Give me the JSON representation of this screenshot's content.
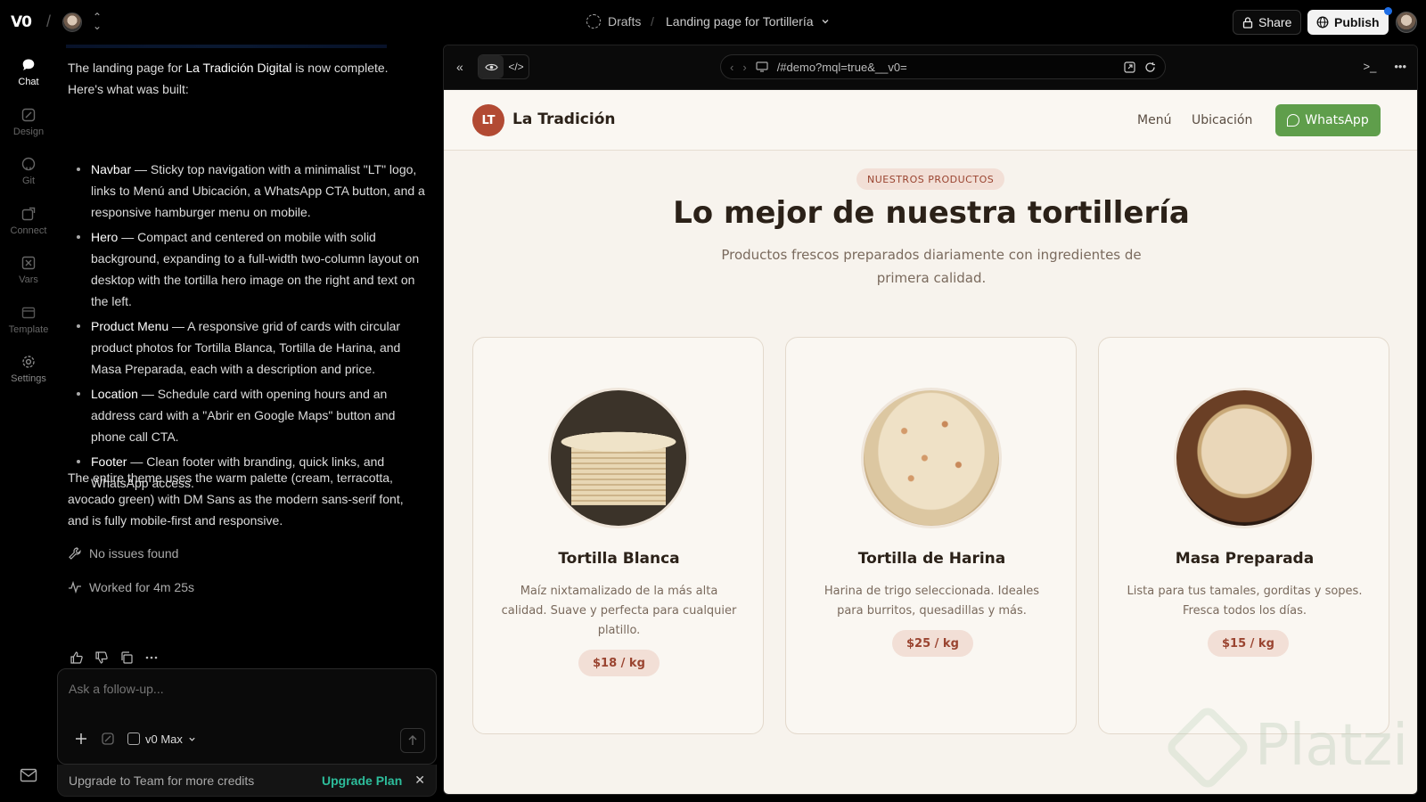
{
  "topbar": {
    "logo": "V0",
    "breadcrumb_drafts": "Drafts",
    "breadcrumb_sep": "/",
    "project_name": "Landing page for Tortillería",
    "share": "Share",
    "publish": "Publish"
  },
  "rail": {
    "items": [
      {
        "label": "Chat",
        "icon": "chat-icon"
      },
      {
        "label": "Design",
        "icon": "design-icon"
      },
      {
        "label": "Git",
        "icon": "github-icon"
      },
      {
        "label": "Connect",
        "icon": "connect-icon"
      },
      {
        "label": "Vars",
        "icon": "vars-icon"
      },
      {
        "label": "Template",
        "icon": "template-icon"
      },
      {
        "label": "Settings",
        "icon": "gear-icon"
      }
    ]
  },
  "chat": {
    "intro_pre": "The landing page for ",
    "intro_name": "La Tradición Digital",
    "intro_post": " is now complete. Here's what was built:",
    "bullets": [
      {
        "title": "Navbar",
        "text": " — Sticky top navigation with a minimalist \"LT\" logo, links to Menú and Ubicación, a WhatsApp CTA button, and a responsive hamburger menu on mobile."
      },
      {
        "title": "Hero",
        "text": " — Compact and centered on mobile with solid background, expanding to a full-width two-column layout on desktop with the tortilla hero image on the right and text on the left."
      },
      {
        "title": "Product Menu",
        "text": " — A responsive grid of cards with circular product photos for Tortilla Blanca, Tortilla de Harina, and Masa Preparada, each with a description and price."
      },
      {
        "title": "Location",
        "text": " — Schedule card with opening hours and an address card with a \"Abrir en Google Maps\" button and phone call CTA."
      },
      {
        "title": "Footer",
        "text": " — Clean footer with branding, quick links, and WhatsApp access."
      }
    ],
    "summary": "The entire theme uses the warm palette (cream, terracotta, avocado green) with DM Sans as the modern sans-serif font, and is fully mobile-first and responsive.",
    "no_issues": "No issues found",
    "worked_for": "Worked for 4m 25s",
    "composer_placeholder": "Ask a follow-up...",
    "model": "v0 Max",
    "upgrade_text": "Upgrade to Team for more credits",
    "upgrade_link": "Upgrade Plan"
  },
  "preview": {
    "url": "/#demo?mql=true&__v0="
  },
  "site": {
    "brand_initials": "LT",
    "brand_name": "La Tradición",
    "nav_menu": "Menú",
    "nav_location": "Ubicación",
    "whatsapp": "WhatsApp",
    "tag": "NUESTROS PRODUCTOS",
    "headline": "Lo mejor de nuestra tortillería",
    "subtitle": "Productos frescos preparados diariamente con ingredientes de primera calidad.",
    "products": [
      {
        "name": "Tortilla Blanca",
        "desc": "Maíz nixtamalizado de la más alta calidad. Suave y perfecta para cualquier platillo.",
        "price": "$18 / kg"
      },
      {
        "name": "Tortilla de Harina",
        "desc": "Harina de trigo seleccionada. Ideales para burritos, quesadillas y más.",
        "price": "$25 / kg"
      },
      {
        "name": "Masa Preparada",
        "desc": "Lista para tus tamales, gorditas y sopes. Fresca todos los días.",
        "price": "$15 / kg"
      }
    ]
  },
  "watermark": "Platzi",
  "colors": {
    "terracotta": "#b24a33",
    "avocado": "#5f9e4b",
    "cream": "#f7f3ed",
    "upgrade_link": "#2dbd9b"
  }
}
